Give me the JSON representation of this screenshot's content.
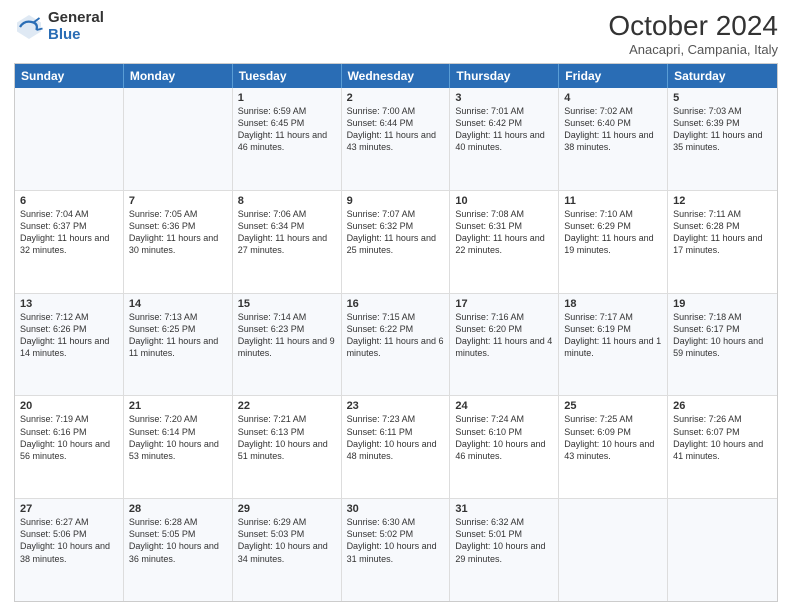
{
  "logo": {
    "general": "General",
    "blue": "Blue"
  },
  "header": {
    "title": "October 2024",
    "subtitle": "Anacapri, Campania, Italy"
  },
  "weekdays": [
    "Sunday",
    "Monday",
    "Tuesday",
    "Wednesday",
    "Thursday",
    "Friday",
    "Saturday"
  ],
  "weeks": [
    [
      {
        "day": "",
        "sunrise": "",
        "sunset": "",
        "daylight": ""
      },
      {
        "day": "",
        "sunrise": "",
        "sunset": "",
        "daylight": ""
      },
      {
        "day": "1",
        "sunrise": "Sunrise: 6:59 AM",
        "sunset": "Sunset: 6:45 PM",
        "daylight": "Daylight: 11 hours and 46 minutes."
      },
      {
        "day": "2",
        "sunrise": "Sunrise: 7:00 AM",
        "sunset": "Sunset: 6:44 PM",
        "daylight": "Daylight: 11 hours and 43 minutes."
      },
      {
        "day": "3",
        "sunrise": "Sunrise: 7:01 AM",
        "sunset": "Sunset: 6:42 PM",
        "daylight": "Daylight: 11 hours and 40 minutes."
      },
      {
        "day": "4",
        "sunrise": "Sunrise: 7:02 AM",
        "sunset": "Sunset: 6:40 PM",
        "daylight": "Daylight: 11 hours and 38 minutes."
      },
      {
        "day": "5",
        "sunrise": "Sunrise: 7:03 AM",
        "sunset": "Sunset: 6:39 PM",
        "daylight": "Daylight: 11 hours and 35 minutes."
      }
    ],
    [
      {
        "day": "6",
        "sunrise": "Sunrise: 7:04 AM",
        "sunset": "Sunset: 6:37 PM",
        "daylight": "Daylight: 11 hours and 32 minutes."
      },
      {
        "day": "7",
        "sunrise": "Sunrise: 7:05 AM",
        "sunset": "Sunset: 6:36 PM",
        "daylight": "Daylight: 11 hours and 30 minutes."
      },
      {
        "day": "8",
        "sunrise": "Sunrise: 7:06 AM",
        "sunset": "Sunset: 6:34 PM",
        "daylight": "Daylight: 11 hours and 27 minutes."
      },
      {
        "day": "9",
        "sunrise": "Sunrise: 7:07 AM",
        "sunset": "Sunset: 6:32 PM",
        "daylight": "Daylight: 11 hours and 25 minutes."
      },
      {
        "day": "10",
        "sunrise": "Sunrise: 7:08 AM",
        "sunset": "Sunset: 6:31 PM",
        "daylight": "Daylight: 11 hours and 22 minutes."
      },
      {
        "day": "11",
        "sunrise": "Sunrise: 7:10 AM",
        "sunset": "Sunset: 6:29 PM",
        "daylight": "Daylight: 11 hours and 19 minutes."
      },
      {
        "day": "12",
        "sunrise": "Sunrise: 7:11 AM",
        "sunset": "Sunset: 6:28 PM",
        "daylight": "Daylight: 11 hours and 17 minutes."
      }
    ],
    [
      {
        "day": "13",
        "sunrise": "Sunrise: 7:12 AM",
        "sunset": "Sunset: 6:26 PM",
        "daylight": "Daylight: 11 hours and 14 minutes."
      },
      {
        "day": "14",
        "sunrise": "Sunrise: 7:13 AM",
        "sunset": "Sunset: 6:25 PM",
        "daylight": "Daylight: 11 hours and 11 minutes."
      },
      {
        "day": "15",
        "sunrise": "Sunrise: 7:14 AM",
        "sunset": "Sunset: 6:23 PM",
        "daylight": "Daylight: 11 hours and 9 minutes."
      },
      {
        "day": "16",
        "sunrise": "Sunrise: 7:15 AM",
        "sunset": "Sunset: 6:22 PM",
        "daylight": "Daylight: 11 hours and 6 minutes."
      },
      {
        "day": "17",
        "sunrise": "Sunrise: 7:16 AM",
        "sunset": "Sunset: 6:20 PM",
        "daylight": "Daylight: 11 hours and 4 minutes."
      },
      {
        "day": "18",
        "sunrise": "Sunrise: 7:17 AM",
        "sunset": "Sunset: 6:19 PM",
        "daylight": "Daylight: 11 hours and 1 minute."
      },
      {
        "day": "19",
        "sunrise": "Sunrise: 7:18 AM",
        "sunset": "Sunset: 6:17 PM",
        "daylight": "Daylight: 10 hours and 59 minutes."
      }
    ],
    [
      {
        "day": "20",
        "sunrise": "Sunrise: 7:19 AM",
        "sunset": "Sunset: 6:16 PM",
        "daylight": "Daylight: 10 hours and 56 minutes."
      },
      {
        "day": "21",
        "sunrise": "Sunrise: 7:20 AM",
        "sunset": "Sunset: 6:14 PM",
        "daylight": "Daylight: 10 hours and 53 minutes."
      },
      {
        "day": "22",
        "sunrise": "Sunrise: 7:21 AM",
        "sunset": "Sunset: 6:13 PM",
        "daylight": "Daylight: 10 hours and 51 minutes."
      },
      {
        "day": "23",
        "sunrise": "Sunrise: 7:23 AM",
        "sunset": "Sunset: 6:11 PM",
        "daylight": "Daylight: 10 hours and 48 minutes."
      },
      {
        "day": "24",
        "sunrise": "Sunrise: 7:24 AM",
        "sunset": "Sunset: 6:10 PM",
        "daylight": "Daylight: 10 hours and 46 minutes."
      },
      {
        "day": "25",
        "sunrise": "Sunrise: 7:25 AM",
        "sunset": "Sunset: 6:09 PM",
        "daylight": "Daylight: 10 hours and 43 minutes."
      },
      {
        "day": "26",
        "sunrise": "Sunrise: 7:26 AM",
        "sunset": "Sunset: 6:07 PM",
        "daylight": "Daylight: 10 hours and 41 minutes."
      }
    ],
    [
      {
        "day": "27",
        "sunrise": "Sunrise: 6:27 AM",
        "sunset": "Sunset: 5:06 PM",
        "daylight": "Daylight: 10 hours and 38 minutes."
      },
      {
        "day": "28",
        "sunrise": "Sunrise: 6:28 AM",
        "sunset": "Sunset: 5:05 PM",
        "daylight": "Daylight: 10 hours and 36 minutes."
      },
      {
        "day": "29",
        "sunrise": "Sunrise: 6:29 AM",
        "sunset": "Sunset: 5:03 PM",
        "daylight": "Daylight: 10 hours and 34 minutes."
      },
      {
        "day": "30",
        "sunrise": "Sunrise: 6:30 AM",
        "sunset": "Sunset: 5:02 PM",
        "daylight": "Daylight: 10 hours and 31 minutes."
      },
      {
        "day": "31",
        "sunrise": "Sunrise: 6:32 AM",
        "sunset": "Sunset: 5:01 PM",
        "daylight": "Daylight: 10 hours and 29 minutes."
      },
      {
        "day": "",
        "sunrise": "",
        "sunset": "",
        "daylight": ""
      },
      {
        "day": "",
        "sunrise": "",
        "sunset": "",
        "daylight": ""
      }
    ]
  ]
}
